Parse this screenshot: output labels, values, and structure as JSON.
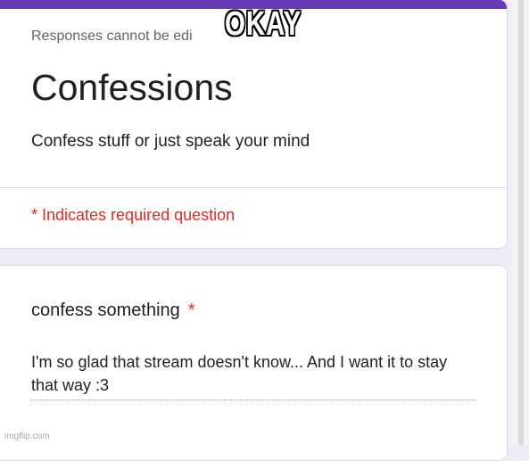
{
  "header": {
    "notice": "Responses cannot be edi",
    "title": "Confessions",
    "description": "Confess stuff or just speak your mind",
    "required_note": "* Indicates required question",
    "accent_color": "#673ab7"
  },
  "question": {
    "title": "confess something",
    "required_marker": "*",
    "answer": "I'm so glad that stream doesn't know... And I want it to stay that way :3"
  },
  "overlay": {
    "caption": "OKAY",
    "watermark": "imgflip.com"
  }
}
